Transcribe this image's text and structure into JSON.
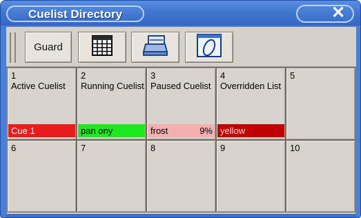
{
  "window": {
    "title": "Cuelist Directory",
    "close_glyph": "✕",
    "accent": "#3b6fc9"
  },
  "toolbar": {
    "guard_label": "Guard",
    "sheet_icon": "spreadsheet-icon",
    "print_icon": "printer-icon",
    "oval_icon": "oval-icon"
  },
  "cells": [
    {
      "num": "1",
      "name": "Active Cuelist",
      "cue": "Cue 1",
      "pct": "",
      "cue_bg": "#e81c1c",
      "cue_fg": "#ffffff"
    },
    {
      "num": "2",
      "name": "Running Cuelist",
      "cue": "pan ony",
      "pct": "",
      "cue_bg": "#1ee81e",
      "cue_fg": "#000000"
    },
    {
      "num": "3",
      "name": "Paused Cuelist",
      "cue": "frost",
      "pct": "9%",
      "cue_bg": "#f4b0b0",
      "cue_fg": "#000000"
    },
    {
      "num": "4",
      "name": "Overridden List",
      "cue": "yellow",
      "pct": "",
      "cue_bg": "#c00000",
      "cue_fg": "#ffd6d6"
    },
    {
      "num": "5",
      "name": "",
      "cue": "",
      "pct": ""
    },
    {
      "num": "6",
      "name": "",
      "cue": "",
      "pct": ""
    },
    {
      "num": "7",
      "name": "",
      "cue": "",
      "pct": ""
    },
    {
      "num": "8",
      "name": "",
      "cue": "",
      "pct": ""
    },
    {
      "num": "9",
      "name": "",
      "cue": "",
      "pct": ""
    },
    {
      "num": "10",
      "name": "",
      "cue": "",
      "pct": ""
    }
  ]
}
